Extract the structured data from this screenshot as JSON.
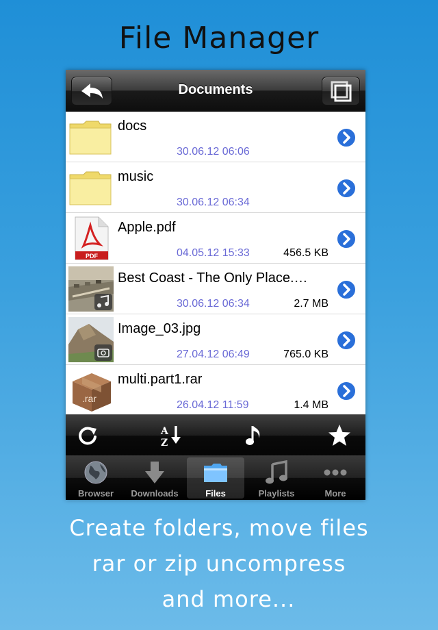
{
  "headline": "File Manager",
  "nav": {
    "title": "Documents"
  },
  "files": [
    {
      "name": "docs",
      "date": "30.06.12 06:06",
      "size": "",
      "kind": "folder"
    },
    {
      "name": "music",
      "date": "30.06.12 06:34",
      "size": "",
      "kind": "folder"
    },
    {
      "name": "Apple.pdf",
      "date": "04.05.12 15:33",
      "size": "456.5 KB",
      "kind": "pdf",
      "badge": "PDF"
    },
    {
      "name": "Best Coast - The Only Place.…",
      "date": "30.06.12 06:34",
      "size": "2.7 MB",
      "kind": "audio"
    },
    {
      "name": "Image_03.jpg",
      "date": "27.04.12 06:49",
      "size": "765.0 KB",
      "kind": "image"
    },
    {
      "name": "multi.part1.rar",
      "date": "26.04.12 11:59",
      "size": "1.4 MB",
      "kind": "rar",
      "badge": ".rar"
    }
  ],
  "toolbar": {
    "sort_glyph": "A↓Z"
  },
  "tabs": [
    {
      "label": "Browser",
      "icon": "globe-icon"
    },
    {
      "label": "Downloads",
      "icon": "download-arrow-icon"
    },
    {
      "label": "Files",
      "icon": "folder-icon",
      "active": true
    },
    {
      "label": "Playlists",
      "icon": "music-note-icon"
    },
    {
      "label": "More",
      "icon": "more-dots-icon"
    }
  ],
  "caption": {
    "line1": "Create folders, move files",
    "line2": "rar or zip uncompress",
    "line3": "and more..."
  },
  "colors": {
    "date_text": "#6a6ad6",
    "disclosure": "#2a6fd9",
    "folder": "#f7e98a"
  }
}
